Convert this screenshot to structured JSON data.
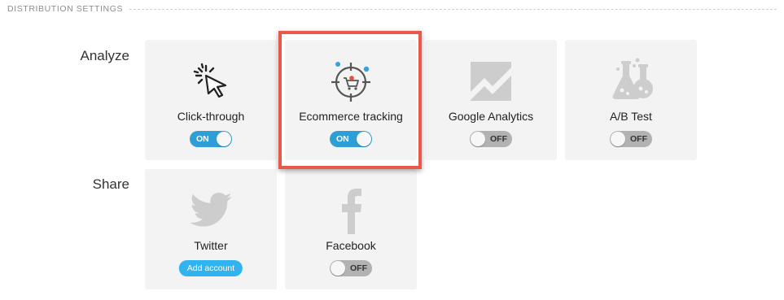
{
  "section": {
    "title": "DISTRIBUTION SETTINGS"
  },
  "analyze": {
    "label": "Analyze",
    "cards": [
      {
        "name": "Click-through",
        "icon": "cursor-click-icon",
        "toggle": "ON"
      },
      {
        "name": "Ecommerce tracking",
        "icon": "ecommerce-target-cart-icon",
        "toggle": "ON"
      },
      {
        "name": "Google Analytics",
        "icon": "google-analytics-icon",
        "toggle": "OFF"
      },
      {
        "name": "A/B Test",
        "icon": "lab-flask-icon",
        "toggle": "OFF"
      }
    ]
  },
  "share": {
    "label": "Share",
    "cards": [
      {
        "name": "Twitter",
        "icon": "twitter-bird-icon",
        "action": "Add account"
      },
      {
        "name": "Facebook",
        "icon": "facebook-f-icon",
        "toggle": "OFF"
      }
    ]
  },
  "colors": {
    "toggle_on": "#2d9fd6",
    "toggle_off": "#b2b2b2",
    "highlight_border": "#e8594a",
    "add_button": "#2fb4f0"
  }
}
